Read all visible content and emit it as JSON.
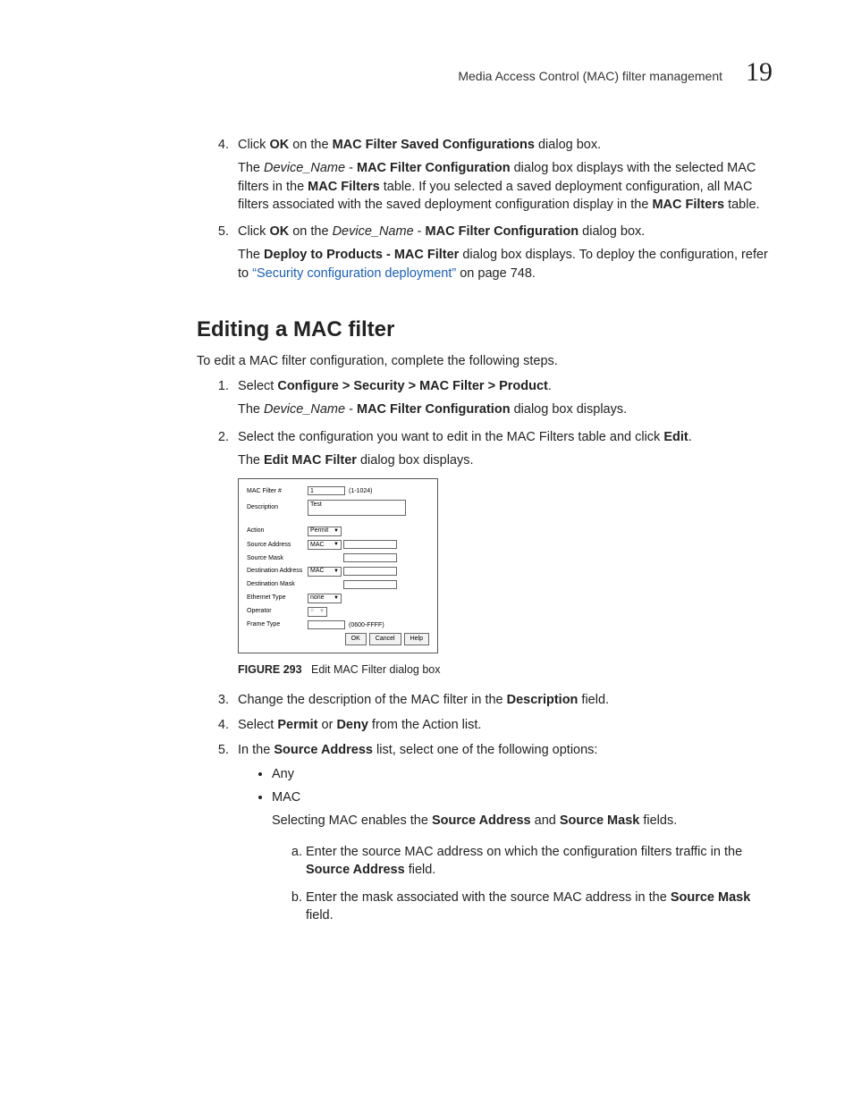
{
  "header": {
    "title": "Media Access Control (MAC) filter management",
    "page": "19"
  },
  "top": {
    "s4_a": "Click ",
    "s4_b": "OK",
    "s4_c": " on the ",
    "s4_d": "MAC Filter Saved Configurations",
    "s4_e": " dialog box.",
    "s4_p_a": "The ",
    "s4_p_b": "Device_Name",
    "s4_p_c": " - ",
    "s4_p_d": "MAC Filter Configuration",
    "s4_p_e": " dialog box displays with the selected MAC filters in the ",
    "s4_p_f": "MAC Filters",
    "s4_p_g": " table. If you selected a saved deployment configuration, all MAC filters associated with the saved deployment configuration display in the ",
    "s4_p_h": "MAC Filters",
    "s4_p_i": " table.",
    "s5_a": "Click ",
    "s5_b": "OK",
    "s5_c": " on the ",
    "s5_d": "Device_Name",
    "s5_e": " - ",
    "s5_f": "MAC Filter Configuration",
    "s5_g": " dialog box.",
    "s5_p_a": "The ",
    "s5_p_b": "Deploy to Products - MAC Filter",
    "s5_p_c": " dialog box displays. To deploy the configuration, refer to ",
    "s5_link": "“Security configuration deployment”",
    "s5_p_after": " on page 748."
  },
  "section": {
    "heading": "Editing a MAC filter",
    "intro": "To edit a MAC filter configuration, complete the following steps."
  },
  "edit": {
    "s1_a": "Select ",
    "s1_b": "Configure > Security > MAC Filter > Product",
    "s1_c": ".",
    "s1_p_a": "The ",
    "s1_p_b": "Device_Name",
    "s1_p_c": " - ",
    "s1_p_d": "MAC Filter Configuration",
    "s1_p_e": " dialog box displays.",
    "s2_a": "Select the configuration you want to edit in the MAC Filters table and click ",
    "s2_b": "Edit",
    "s2_c": ".",
    "s2_p_a": "The ",
    "s2_p_b": "Edit MAC Filter",
    "s2_p_c": " dialog box displays.",
    "s3_a": "Change the description of the MAC filter in the ",
    "s3_b": "Description",
    "s3_c": " field.",
    "s4_a": "Select ",
    "s4_b": "Permit",
    "s4_c": " or ",
    "s4_d": "Deny",
    "s4_e": " from the Action list.",
    "s5_a": "In the ",
    "s5_b": "Source Address",
    "s5_c": " list, select one of the following options:",
    "bullets": {
      "b1": "Any",
      "b2": "MAC"
    },
    "mac_note_a": "Selecting MAC enables the ",
    "mac_note_b": "Source Address",
    "mac_note_c": " and ",
    "mac_note_d": "Source Mask",
    "mac_note_e": " fields.",
    "a_a": "Enter the source MAC address on which the configuration filters traffic in the ",
    "a_b": "Source Address",
    "a_c": " field.",
    "b_a": "Enter the mask associated with the source MAC address in the ",
    "b_b": "Source Mask",
    "b_c": " field."
  },
  "dialog": {
    "mac_filter_label": "MAC Filter #",
    "mac_filter_value": "1",
    "mac_filter_hint": "(1-1024)",
    "description_label": "Description",
    "description_value": "Test",
    "action_label": "Action",
    "action_value": "Permit",
    "source_address_label": "Source Address",
    "source_address_value": "MAC",
    "source_mask_label": "Source Mask",
    "destination_address_label": "Destination Address",
    "destination_address_value": "MAC",
    "destination_mask_label": "Destination Mask",
    "ethernet_type_label": "Ethernet Type",
    "ethernet_type_value": "none",
    "operator_label": "Operator",
    "operator_value": "=",
    "frame_type_label": "Frame Type",
    "frame_type_hint": "(0600-FFFF)",
    "ok": "OK",
    "cancel": "Cancel",
    "help": "Help"
  },
  "figure": {
    "label": "FIGURE 293",
    "caption": "Edit MAC Filter dialog box"
  }
}
